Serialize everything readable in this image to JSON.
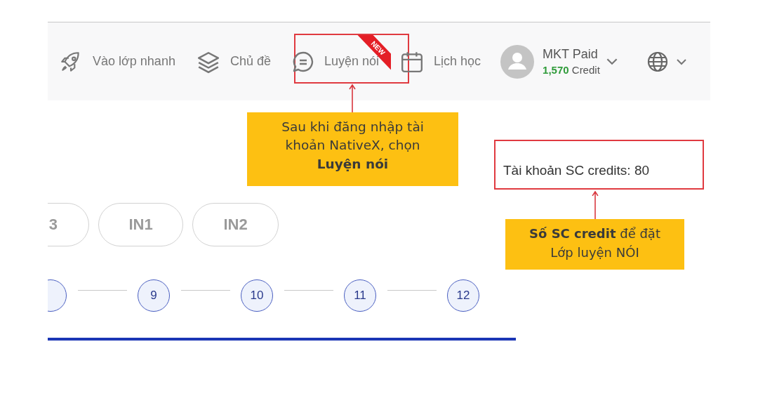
{
  "nav": {
    "items": [
      {
        "label": "Vào lớp nhanh",
        "kind": "rocket"
      },
      {
        "label": "Chủ đề",
        "kind": "layers"
      },
      {
        "label": "Luyện nói",
        "kind": "chat",
        "badge": "NEW"
      },
      {
        "label": "Lịch học",
        "kind": "calendar"
      }
    ],
    "user": {
      "name": "MKT Paid",
      "credit_amount": "1,570",
      "credit_unit": "Credit"
    }
  },
  "levels": [
    {
      "label": "3"
    },
    {
      "label": "IN1"
    },
    {
      "label": "IN2"
    }
  ],
  "steps": [
    "9",
    "10",
    "11",
    "12"
  ],
  "account_info": "Tài khoản SC credits: 80",
  "annotations": [
    {
      "text": "Sau khi đăng nhập tài khoản NativeX, chọn **Luyện nói**"
    },
    {
      "text": "**Số SC credit** để đặt Lớp luyện NÓI"
    }
  ]
}
